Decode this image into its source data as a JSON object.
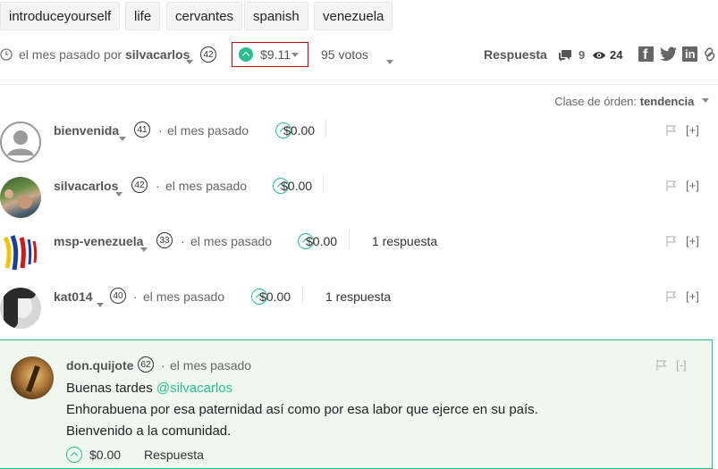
{
  "tags": [
    "introduceyourself",
    "life",
    "cervantes",
    "spanish",
    "venezuela"
  ],
  "post_meta": {
    "time": "el mes pasado por",
    "author": "silvacarlos",
    "rep": "42",
    "payout": "$9.11",
    "votes": "95 votos",
    "reply_label": "Respuesta",
    "comments_count": "9",
    "views_count": "24"
  },
  "sort": {
    "label": "Clase de órden:",
    "value": "tendencia"
  },
  "comments": [
    {
      "author": "bienvenida",
      "rep": "41",
      "time": "el mes pasado",
      "payout": "$0.00",
      "replies": "",
      "expand": "[+]"
    },
    {
      "author": "silvacarlos",
      "rep": "42",
      "time": "el mes pasado",
      "payout": "$0.00",
      "replies": "",
      "expand": "[+]"
    },
    {
      "author": "msp-venezuela",
      "rep": "33",
      "time": "el mes pasado",
      "payout": "$0.00",
      "replies": "1 respuesta",
      "expand": "[+]"
    },
    {
      "author": "kat014",
      "rep": "40",
      "time": "el mes pasado",
      "payout": "$0.00",
      "replies": "1 respuesta",
      "expand": "[+]"
    }
  ],
  "featured": {
    "author": "don.quijote",
    "rep": "62",
    "time": "el mes pasado",
    "collapse": "[-]",
    "greeting": "Buenas tardes",
    "mention": "@silvacarlos",
    "line2": "Enhorabuena por esa paternidad así como por esa labor que ejerce en su país.",
    "line3": "Bienvenido a la comunidad.",
    "payout": "$0.00",
    "reply_label": "Respuesta"
  },
  "colors": {
    "accent": "#2bbd8d",
    "highlight_border": "#cc0000",
    "featured_bg": "#eef8ee"
  }
}
